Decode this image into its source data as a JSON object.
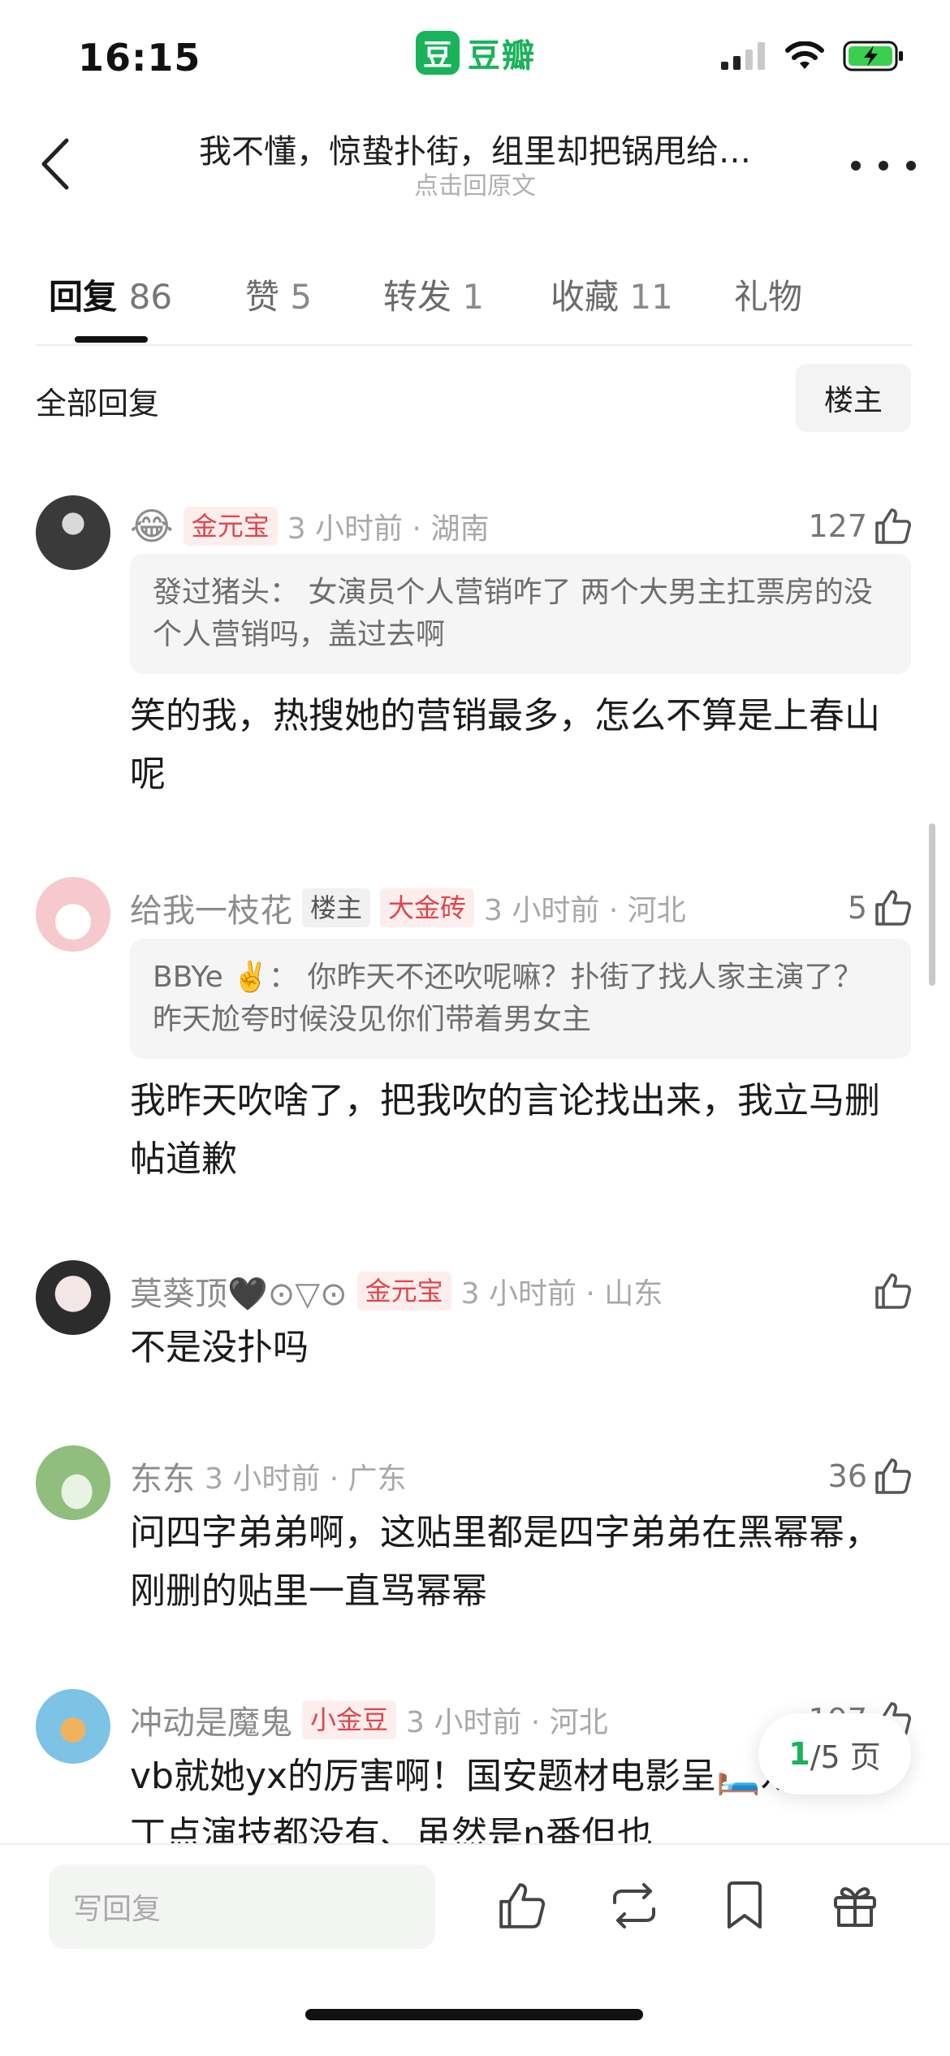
{
  "status_bar": {
    "time": "16:15",
    "brand_logo": "豆",
    "brand_name": "豆瓣"
  },
  "nav": {
    "title": "我不懂，惊蛰扑街，组里却把锅甩给…",
    "subtitle": "点击回原文"
  },
  "tabs": [
    {
      "label": "回复",
      "count": "86"
    },
    {
      "label": "赞",
      "count": "5"
    },
    {
      "label": "转发",
      "count": "1"
    },
    {
      "label": "收藏",
      "count": "11"
    },
    {
      "label": "礼物",
      "count": ""
    }
  ],
  "filter": {
    "label": "全部回复",
    "op_button": "楼主"
  },
  "comments": [
    {
      "username": "😂",
      "badges": [
        "金元宝"
      ],
      "time_loc": "3 小时前 · 湖南",
      "likes": "127",
      "quote": "發过猪头：  女演员个人营销咋了 两个大男主扛票房的没个人营销吗，盖过去啊",
      "text": "笑的我，热搜她的营销最多，怎么不算是上春山呢"
    },
    {
      "username": "给我一枝花",
      "badge_op": "楼主",
      "badges": [
        "大金砖"
      ],
      "time_loc": "3 小时前 · 河北",
      "likes": "5",
      "quote": "BBYe ✌️：  你昨天不还吹呢嘛？扑街了找人家主演了？昨天尬夸时候没见你们带着男女主",
      "text": "我昨天吹啥了，把我吹的言论找出来，我立马删帖道歉"
    },
    {
      "username": "莫葵顶🖤⊙▽⊙",
      "badges": [
        "金元宝"
      ],
      "time_loc": "3 小时前 · 山东",
      "likes": "",
      "text": "不是没扑吗"
    },
    {
      "username": "东东",
      "badges": [],
      "time_loc": "3 小时前 · 广东",
      "likes": "36",
      "text": "问四字弟弟啊，这贴里都是四字弟弟在黑幂幂，刚删的贴里一直骂幂幂"
    },
    {
      "username": "冲动是魔鬼",
      "badges": [
        "小金豆"
      ],
      "time_loc": "3 小时前 · 河北",
      "likes": "197",
      "text": "vb就她yx的厉害啊！国安题材电影呈🛏️戏、一丁点演技都没有、虽然是n番但也"
    }
  ],
  "page_indicator": {
    "current": "1",
    "total": "/5 页"
  },
  "bottom_bar": {
    "reply_placeholder": "写回复"
  },
  "colors": {
    "brand": "#18b35a",
    "badge_red": "#e0454b",
    "text_main": "#1b1b1b",
    "text_meta": "#a8a8a8"
  }
}
